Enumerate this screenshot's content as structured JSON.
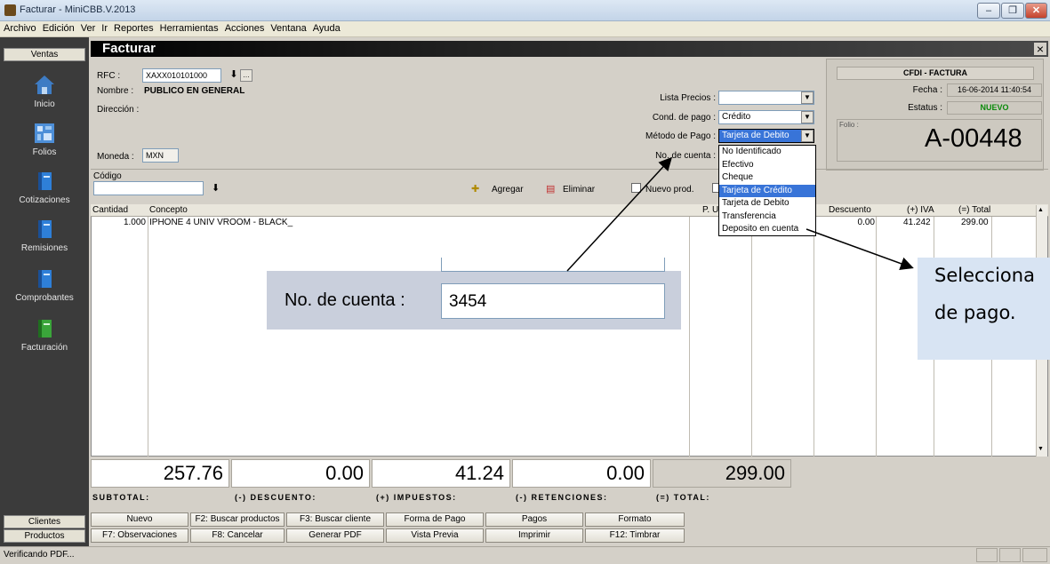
{
  "window": {
    "title": "Facturar - MiniCBB.V.2013",
    "buttons": [
      "‒",
      "❐",
      "✕"
    ]
  },
  "menu": [
    "Archivo",
    "Edición",
    "Ver",
    "Ir",
    "Reportes",
    "Herramientas",
    "Acciones",
    "Ventana",
    "Ayuda"
  ],
  "sidebar": {
    "header": "Ventas",
    "items": [
      {
        "label": "Inicio",
        "icon": "home-icon"
      },
      {
        "label": "Folios",
        "icon": "folios-icon"
      },
      {
        "label": "Cotizaciones",
        "icon": "book-icon"
      },
      {
        "label": "Remisiones",
        "icon": "book-icon"
      },
      {
        "label": "Comprobantes",
        "icon": "book-icon"
      },
      {
        "label": "Facturación",
        "icon": "invoice-icon"
      }
    ],
    "footer": [
      "Clientes",
      "Productos"
    ]
  },
  "panel": {
    "title": "Facturar",
    "close": "×"
  },
  "client": {
    "rfc_label": "RFC :",
    "rfc_value": "XAXX010101000",
    "nombre_label": "Nombre :",
    "nombre_value": "PUBLICO EN GENERAL",
    "direccion_label": "Dirección :",
    "moneda_label": "Moneda :",
    "moneda_value": "MXN"
  },
  "payment": {
    "lista_label": "Lista Precios :",
    "lista_value": "",
    "cond_label": "Cond. de pago :",
    "cond_value": "Crédito",
    "metodo_label": "Método de Pago :",
    "metodo_value": "Tarjeta de Debito",
    "cuenta_label": "No. de cuenta :",
    "options": [
      "No Identificado",
      "Efectivo",
      "Cheque",
      "Tarjeta de Crédito",
      "Tarjeta de Debito",
      "Transferencia",
      "Deposito en cuenta"
    ],
    "highlighted_option": "Tarjeta de Crédito"
  },
  "cfdi": {
    "title": "CFDI - FACTURA",
    "fecha_label": "Fecha :",
    "fecha_value": "16-06-2014 11:40:54",
    "estatus_label": "Estatus :",
    "estatus_value": "NUEVO",
    "folio_label": "Folio :",
    "folio_value": "A-00448"
  },
  "toolbar": {
    "codigo_label": "Código",
    "agregar": "Agregar",
    "eliminar": "Eliminar",
    "nuevo_prod": "Nuevo prod."
  },
  "table": {
    "headers": [
      "Cantidad",
      "Concepto",
      "P. Unita",
      "Descuento",
      "(+) IVA",
      "(=) Total"
    ],
    "rows": [
      {
        "cantidad": "1.000",
        "concepto": "IPHONE 4 UNIV VROOM - BLACK_",
        "descuento": "0.00",
        "iva": "41.242",
        "total": "299.00"
      }
    ]
  },
  "zoom": {
    "label": "No. de cuenta :",
    "value": "3454"
  },
  "callout": {
    "line1": "Selecciona",
    "line2": "de pago."
  },
  "totals": {
    "subtotal": "257.76",
    "subtotal_label": "SUBTOTAL:",
    "descuento": "0.00",
    "descuento_label": "(-) DESCUENTO:",
    "impuestos": "41.24",
    "impuestos_label": "(+) IMPUESTOS:",
    "retenciones": "0.00",
    "retenciones_label": "(-) RETENCIONES:",
    "total": "299.00",
    "total_label": "(=) TOTAL:"
  },
  "buttons": {
    "row1": [
      "Nuevo",
      "F2: Buscar productos",
      "F3: Buscar cliente",
      "Forma de Pago",
      "Pagos",
      "Formato"
    ],
    "row2": [
      "F7: Observaciones",
      "F8: Cancelar",
      "Generar PDF",
      "Vista Previa",
      "Imprimir",
      "F12:  Timbrar"
    ]
  },
  "status": {
    "text": "Verificando PDF..."
  },
  "colors": {
    "selection": "#3874d8",
    "status_new": "#0a8a0a",
    "sidebar": "#3b3b3b"
  }
}
